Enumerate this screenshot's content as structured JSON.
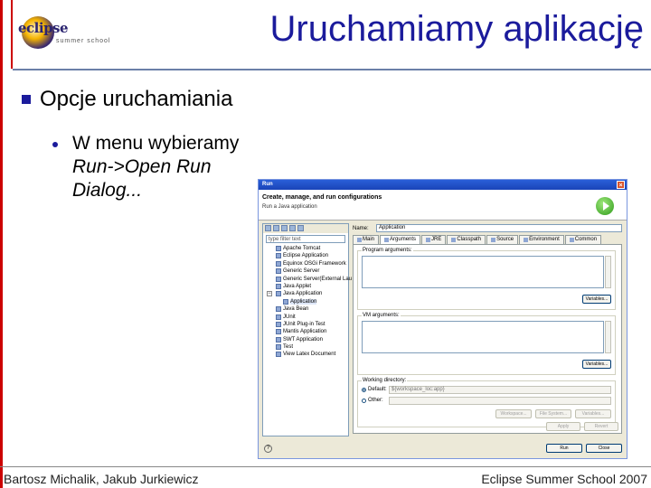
{
  "slide": {
    "title": "Uruchamiamy aplikację",
    "logo_word": "eclipse",
    "logo_sub": "summer school",
    "bullet1": "Opcje uruchamiania",
    "bullet2_line1": "W menu wybieramy",
    "bullet2_line2": "Run->Open Run",
    "bullet2_line3": "Dialog...",
    "footer_left": "Bartosz Michalik, Jakub Jurkiewicz",
    "footer_right": "Eclipse Summer School 2007",
    "accent_color": "#1b1b9c",
    "brand_red": "#cc0000"
  },
  "dialog": {
    "title": "Run",
    "close": "×",
    "header_title": "Create, manage, and run configurations",
    "header_sub": "Run a Java application",
    "filter_placeholder": "type filter text",
    "tree": [
      {
        "label": "Apache Tomcat",
        "level": 0
      },
      {
        "label": "Eclipse Application",
        "level": 0
      },
      {
        "label": "Equinox OSGi Framework",
        "level": 0
      },
      {
        "label": "Generic Server",
        "level": 0
      },
      {
        "label": "Generic Server(External Lau",
        "level": 0
      },
      {
        "label": "Java Applet",
        "level": 0
      },
      {
        "label": "Java Application",
        "level": 0,
        "expanded": true
      },
      {
        "label": "Application",
        "level": 1,
        "selected": true
      },
      {
        "label": "Java Bean",
        "level": 0
      },
      {
        "label": "JUnit",
        "level": 0
      },
      {
        "label": "JUnit Plug-in Test",
        "level": 0
      },
      {
        "label": "Mantis Application",
        "level": 0
      },
      {
        "label": "SWT Application",
        "level": 0
      },
      {
        "label": "Test",
        "level": 0
      },
      {
        "label": "View Latex Document",
        "level": 0
      }
    ],
    "name_label": "Name:",
    "name_value": "Application",
    "tabs": [
      "Main",
      "Arguments",
      "JRE",
      "Classpath",
      "Source",
      "Environment",
      "Common"
    ],
    "active_tab": 1,
    "program_args_label": "Program arguments:",
    "vm_args_label": "VM arguments:",
    "variables_label": "Variables...",
    "working_dir_label": "Working directory:",
    "default_label": "Default:",
    "default_value": "${workspace_loc:app}",
    "other_label": "Other:",
    "workspace_btn": "Workspace...",
    "filesystem_btn": "File System...",
    "variables2_btn": "Variables...",
    "apply_btn": "Apply",
    "revert_btn": "Revert",
    "run_btn": "Run",
    "close_btn": "Close",
    "help": "?"
  }
}
